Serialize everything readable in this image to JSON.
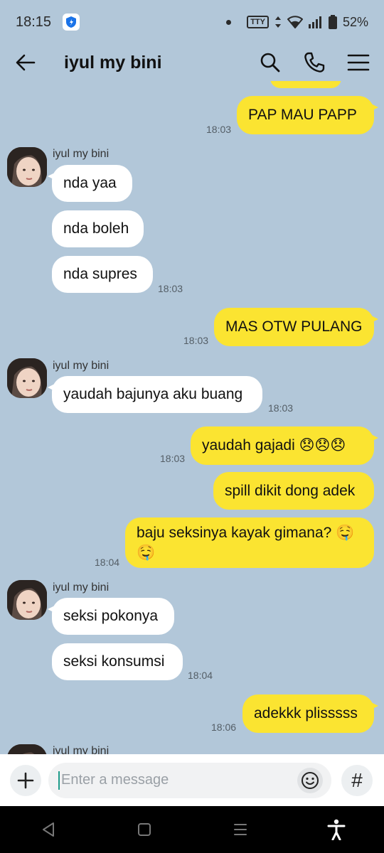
{
  "status_bar": {
    "time": "18:15",
    "tty": "TTY",
    "battery": "52%"
  },
  "header": {
    "title": "iyul my bini"
  },
  "messages": {
    "m1": {
      "text": "PAP MAU PAPP",
      "time": "18:03"
    },
    "g1": {
      "sender": "iyul my bini",
      "b1": "nda yaa",
      "b2": "nda boleh",
      "b3": "nda supres",
      "time": "18:03"
    },
    "m2": {
      "text": "MAS OTW PULANG",
      "time": "18:03"
    },
    "g2": {
      "sender": "iyul my bini",
      "b1": "yaudah bajunya aku buang",
      "time": "18:03"
    },
    "m3": {
      "text": "yaudah gajadi 😞😞😞",
      "time": "18:03"
    },
    "m4": {
      "text": "spill dikit dong adek"
    },
    "m5": {
      "line1": "baju seksinya kayak gimana? 🤤",
      "line2": "🤤",
      "time": "18:04"
    },
    "g3": {
      "sender": "iyul my bini",
      "b1": "seksi pokonya",
      "b2": "seksi konsumsi",
      "time": "18:04"
    },
    "m6": {
      "text": "adekkk plisssss",
      "time": "18:06"
    },
    "g4": {
      "sender": "iyul my bini"
    }
  },
  "composer": {
    "placeholder": "Enter a message",
    "hash": "#"
  },
  "icons": [
    "shield-icon",
    "back-arrow-icon",
    "search-icon",
    "phone-icon",
    "menu-icon",
    "plus-icon",
    "emoji-icon",
    "hash-icon",
    "nav-back-icon",
    "nav-home-icon",
    "nav-recents-icon",
    "accessibility-icon"
  ],
  "colors": {
    "background": "#b2c7d9",
    "my_bubble": "#fbe431",
    "their_bubble": "#ffffff"
  }
}
